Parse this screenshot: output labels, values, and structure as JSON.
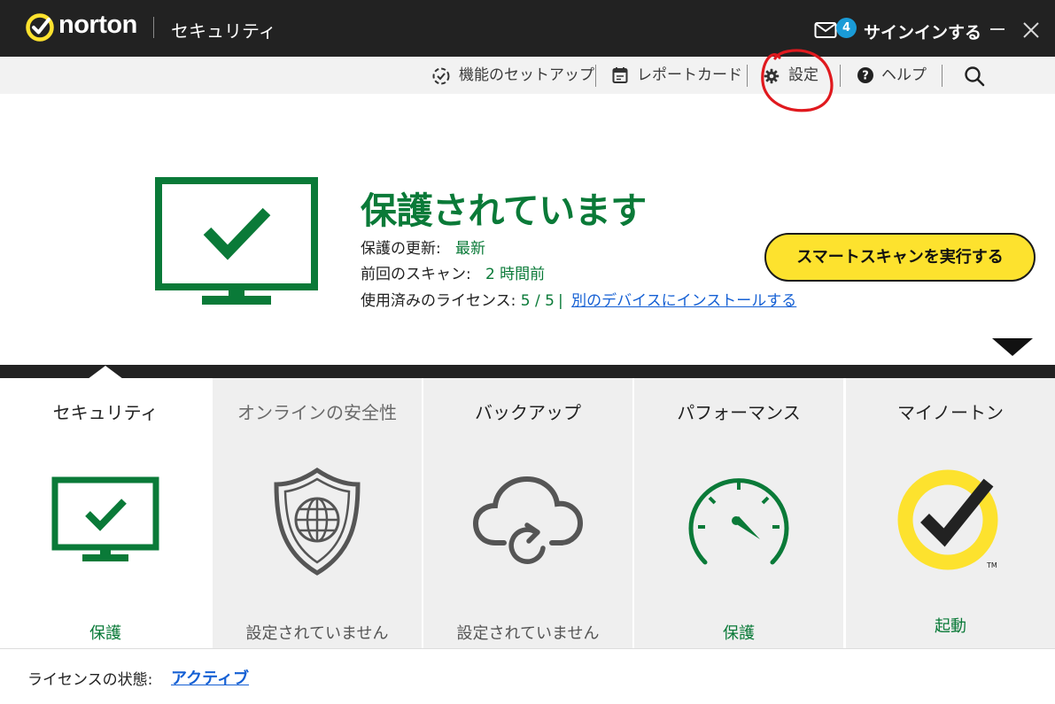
{
  "titlebar": {
    "brand": "norton",
    "app_title": "セキュリティ",
    "mail_count": "4",
    "signin_label": "サインインする"
  },
  "toolbar": {
    "items": [
      {
        "label": "機能のセットアップ",
        "icon": "feature-setup-icon"
      },
      {
        "label": "レポートカード",
        "icon": "calendar-icon"
      },
      {
        "label": "設定",
        "icon": "gear-icon"
      },
      {
        "label": "ヘルプ",
        "icon": "help-icon"
      }
    ],
    "search_icon": "search-icon"
  },
  "annotation": {
    "shape": "hand-drawn circle",
    "color": "#e0191e"
  },
  "hero": {
    "status_title": "保護されています",
    "update_label": "保護の更新:",
    "update_value": "最新",
    "last_scan_label": "前回のスキャン:",
    "last_scan_value": "2 時間前",
    "licenses_label": "使用済みのライセンス:",
    "licenses_value": "5 / 5",
    "install_link": "別のデバイスにインストールする",
    "scan_button": "スマートスキャンを実行する"
  },
  "tabs": [
    {
      "label": "セキュリティ",
      "status": "保護",
      "icon": "monitor-check-icon",
      "active": true
    },
    {
      "label": "オンラインの安全性",
      "status": "設定されていません",
      "icon": "shield-globe-icon",
      "active": false
    },
    {
      "label": "バックアップ",
      "status": "設定されていません",
      "icon": "cloud-sync-icon",
      "active": false
    },
    {
      "label": "パフォーマンス",
      "status": "保護",
      "icon": "speedometer-icon",
      "active": false
    },
    {
      "label": "マイノートン",
      "status": "起動",
      "icon": "norton-badge-icon",
      "active": false
    }
  ],
  "footer": {
    "license_label": "ライセンスの状態:",
    "license_value": "アクティブ"
  },
  "colors": {
    "titlebar": "#222222",
    "toolbar": "#f2f2f2",
    "protected_green": "#0a7a38",
    "scan_button_yellow": "#fde22e",
    "link_blue": "#1560d4",
    "badge_blue": "#1a9bd7",
    "annotation_red": "#e0191e",
    "norton_yellow": "#fde22e"
  }
}
